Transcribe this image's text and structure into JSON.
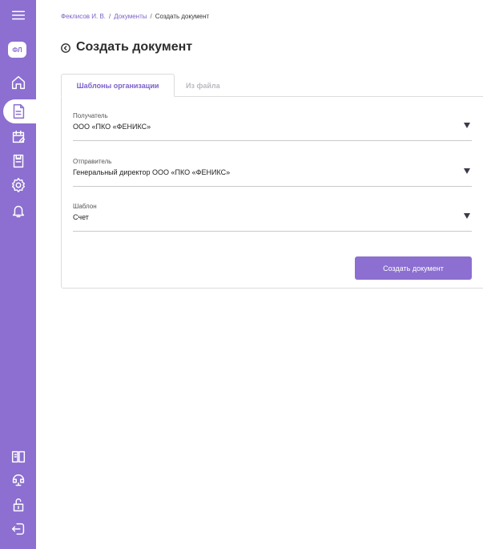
{
  "sidebar": {
    "avatar_text": "ФЛ",
    "top_icons": [
      "menu-icon",
      "home-icon",
      "documents-icon",
      "calendar-edit-icon",
      "reports-icon",
      "settings-icon",
      "notifications-icon"
    ],
    "bottom_icons": [
      "book-icon",
      "support-icon",
      "lock-icon",
      "logout-icon"
    ]
  },
  "breadcrumb": {
    "items": [
      "Феклисов И. В.",
      "Документы",
      "Создать документ"
    ],
    "separator": "/"
  },
  "page_title": "Создать документ",
  "tabs": [
    {
      "label": "Шаблоны организации",
      "active": true
    },
    {
      "label": "Из файла",
      "active": false
    }
  ],
  "form": {
    "recipient": {
      "label": "Получатель",
      "value": "ООО «ПКО «ФЕНИКС»"
    },
    "sender": {
      "label": "Отправитель",
      "value": "Генеральный директор ООО «ПКО «ФЕНИКС»"
    },
    "template": {
      "label": "Шаблон",
      "value": "Счет"
    },
    "submit_label": "Создать документ"
  },
  "colors": {
    "accent": "#8c6fd0",
    "link": "#7b61c9"
  }
}
